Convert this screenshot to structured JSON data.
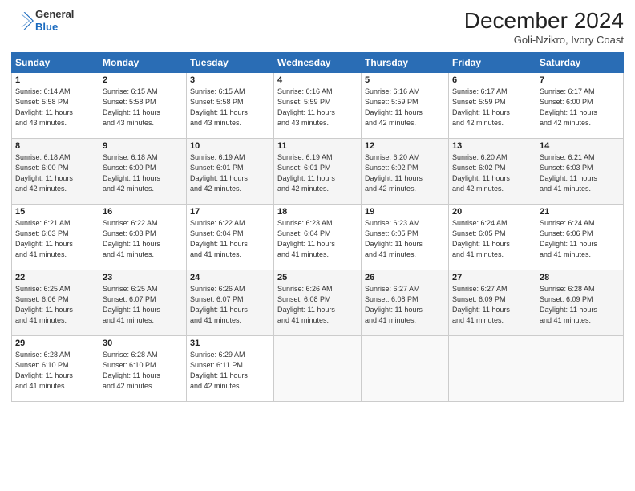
{
  "logo": {
    "line1": "General",
    "line2": "Blue"
  },
  "title": "December 2024",
  "location": "Goli-Nzikro, Ivory Coast",
  "days_of_week": [
    "Sunday",
    "Monday",
    "Tuesday",
    "Wednesday",
    "Thursday",
    "Friday",
    "Saturday"
  ],
  "weeks": [
    [
      {
        "day": "1",
        "info": "Sunrise: 6:14 AM\nSunset: 5:58 PM\nDaylight: 11 hours\nand 43 minutes."
      },
      {
        "day": "2",
        "info": "Sunrise: 6:15 AM\nSunset: 5:58 PM\nDaylight: 11 hours\nand 43 minutes."
      },
      {
        "day": "3",
        "info": "Sunrise: 6:15 AM\nSunset: 5:58 PM\nDaylight: 11 hours\nand 43 minutes."
      },
      {
        "day": "4",
        "info": "Sunrise: 6:16 AM\nSunset: 5:59 PM\nDaylight: 11 hours\nand 43 minutes."
      },
      {
        "day": "5",
        "info": "Sunrise: 6:16 AM\nSunset: 5:59 PM\nDaylight: 11 hours\nand 42 minutes."
      },
      {
        "day": "6",
        "info": "Sunrise: 6:17 AM\nSunset: 5:59 PM\nDaylight: 11 hours\nand 42 minutes."
      },
      {
        "day": "7",
        "info": "Sunrise: 6:17 AM\nSunset: 6:00 PM\nDaylight: 11 hours\nand 42 minutes."
      }
    ],
    [
      {
        "day": "8",
        "info": "Sunrise: 6:18 AM\nSunset: 6:00 PM\nDaylight: 11 hours\nand 42 minutes."
      },
      {
        "day": "9",
        "info": "Sunrise: 6:18 AM\nSunset: 6:00 PM\nDaylight: 11 hours\nand 42 minutes."
      },
      {
        "day": "10",
        "info": "Sunrise: 6:19 AM\nSunset: 6:01 PM\nDaylight: 11 hours\nand 42 minutes."
      },
      {
        "day": "11",
        "info": "Sunrise: 6:19 AM\nSunset: 6:01 PM\nDaylight: 11 hours\nand 42 minutes."
      },
      {
        "day": "12",
        "info": "Sunrise: 6:20 AM\nSunset: 6:02 PM\nDaylight: 11 hours\nand 42 minutes."
      },
      {
        "day": "13",
        "info": "Sunrise: 6:20 AM\nSunset: 6:02 PM\nDaylight: 11 hours\nand 42 minutes."
      },
      {
        "day": "14",
        "info": "Sunrise: 6:21 AM\nSunset: 6:03 PM\nDaylight: 11 hours\nand 41 minutes."
      }
    ],
    [
      {
        "day": "15",
        "info": "Sunrise: 6:21 AM\nSunset: 6:03 PM\nDaylight: 11 hours\nand 41 minutes."
      },
      {
        "day": "16",
        "info": "Sunrise: 6:22 AM\nSunset: 6:03 PM\nDaylight: 11 hours\nand 41 minutes."
      },
      {
        "day": "17",
        "info": "Sunrise: 6:22 AM\nSunset: 6:04 PM\nDaylight: 11 hours\nand 41 minutes."
      },
      {
        "day": "18",
        "info": "Sunrise: 6:23 AM\nSunset: 6:04 PM\nDaylight: 11 hours\nand 41 minutes."
      },
      {
        "day": "19",
        "info": "Sunrise: 6:23 AM\nSunset: 6:05 PM\nDaylight: 11 hours\nand 41 minutes."
      },
      {
        "day": "20",
        "info": "Sunrise: 6:24 AM\nSunset: 6:05 PM\nDaylight: 11 hours\nand 41 minutes."
      },
      {
        "day": "21",
        "info": "Sunrise: 6:24 AM\nSunset: 6:06 PM\nDaylight: 11 hours\nand 41 minutes."
      }
    ],
    [
      {
        "day": "22",
        "info": "Sunrise: 6:25 AM\nSunset: 6:06 PM\nDaylight: 11 hours\nand 41 minutes."
      },
      {
        "day": "23",
        "info": "Sunrise: 6:25 AM\nSunset: 6:07 PM\nDaylight: 11 hours\nand 41 minutes."
      },
      {
        "day": "24",
        "info": "Sunrise: 6:26 AM\nSunset: 6:07 PM\nDaylight: 11 hours\nand 41 minutes."
      },
      {
        "day": "25",
        "info": "Sunrise: 6:26 AM\nSunset: 6:08 PM\nDaylight: 11 hours\nand 41 minutes."
      },
      {
        "day": "26",
        "info": "Sunrise: 6:27 AM\nSunset: 6:08 PM\nDaylight: 11 hours\nand 41 minutes."
      },
      {
        "day": "27",
        "info": "Sunrise: 6:27 AM\nSunset: 6:09 PM\nDaylight: 11 hours\nand 41 minutes."
      },
      {
        "day": "28",
        "info": "Sunrise: 6:28 AM\nSunset: 6:09 PM\nDaylight: 11 hours\nand 41 minutes."
      }
    ],
    [
      {
        "day": "29",
        "info": "Sunrise: 6:28 AM\nSunset: 6:10 PM\nDaylight: 11 hours\nand 41 minutes."
      },
      {
        "day": "30",
        "info": "Sunrise: 6:28 AM\nSunset: 6:10 PM\nDaylight: 11 hours\nand 42 minutes."
      },
      {
        "day": "31",
        "info": "Sunrise: 6:29 AM\nSunset: 6:11 PM\nDaylight: 11 hours\nand 42 minutes."
      },
      null,
      null,
      null,
      null
    ]
  ]
}
